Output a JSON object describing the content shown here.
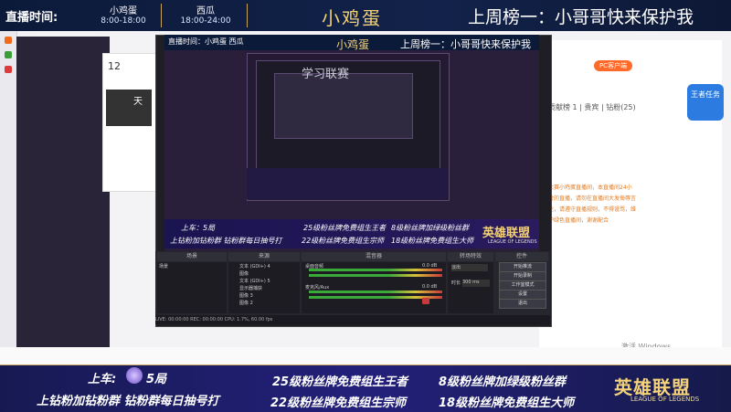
{
  "overlay_top": {
    "schedule_label": "直播时间:",
    "host_a": {
      "name": "小鸡蛋",
      "time": "8:00-18:00"
    },
    "host_b": {
      "name": "西瓜",
      "time": "18:00-24:00"
    },
    "brand": "小鸡蛋",
    "weekly_rank": "上周榜一：小哥哥快来保护我"
  },
  "browser": {
    "card_count": "12",
    "avatar_text": "天",
    "pc_button": "PC客户端",
    "hero_badge": "王者任务",
    "tab_row": "贡献榜 1 | 贵宾 | 钻粉(25)",
    "orange_text": "大赛小鸡蛋直播间，本直播间24小时的直播，请勿在直播间大发侮辱言论，请遵守直播规则，不得谩骂，维护绿色直播间，谢谢配合",
    "windows_watermark": "激活 Windows"
  },
  "obs": {
    "mini_title": "直播时间：小鸡蛋 西瓜",
    "mini_brand": "小鸡蛋",
    "mini_weekly": "上周榜一：小哥哥快来保护我",
    "inner_ghost": "学习联赛",
    "mini_banner": {
      "line1": "上车：5局",
      "line2": "上钻粉加钻粉群 钻粉群每日抽号打",
      "mid1": "25级粉丝牌免费组生王者",
      "mid2": "22级粉丝牌免费组生宗师",
      "right1": "8级粉丝牌加绿级粉丝群",
      "right2": "18级粉丝牌免费组生大师",
      "lol": "英雄联盟",
      "lol_sub": "LEAGUE OF LEGENDS"
    },
    "dock_headers": [
      "场景",
      "来源",
      "混音器",
      "转场特效",
      "控件"
    ],
    "scenes": [
      "场景"
    ],
    "sources": [
      "文本 (GDI+) 4",
      "图像",
      "文本 (GDI+) 5",
      "显示器捕获",
      "图像 3",
      "图像 2"
    ],
    "mixer": [
      {
        "name": "桌面音频",
        "level": "0.0 dB"
      },
      {
        "name": "麦克风/Aux",
        "level": "0.0 dB"
      }
    ],
    "transition": {
      "type": "淡出",
      "duration_label": "时长",
      "duration": "300 ms"
    },
    "controls": [
      "开始推流",
      "开始录制",
      "工作室模式",
      "设置",
      "退出"
    ],
    "status": "LIVE: 00:00:00   REC: 00:00:00   CPU: 1.7%, 60.00 fps"
  },
  "bottom_banner": {
    "board": "上车:",
    "rank": "5局",
    "left2": "上钻粉加钻粉群 钻粉群每日抽号打",
    "mid1": "25级粉丝牌免费组生王者",
    "mid2": "22级粉丝牌免费组生宗师",
    "right1": "8级粉丝牌加绿级粉丝群",
    "right2": "18级粉丝牌免费组生大师",
    "logo": "英雄联盟",
    "logo_sub": "LEAGUE OF LEGENDS"
  },
  "colors": {
    "gold": "#c9a45a",
    "banner_navy": "#171a52",
    "obs_dark": "#1e1e24",
    "orange": "#ff6a2a"
  }
}
